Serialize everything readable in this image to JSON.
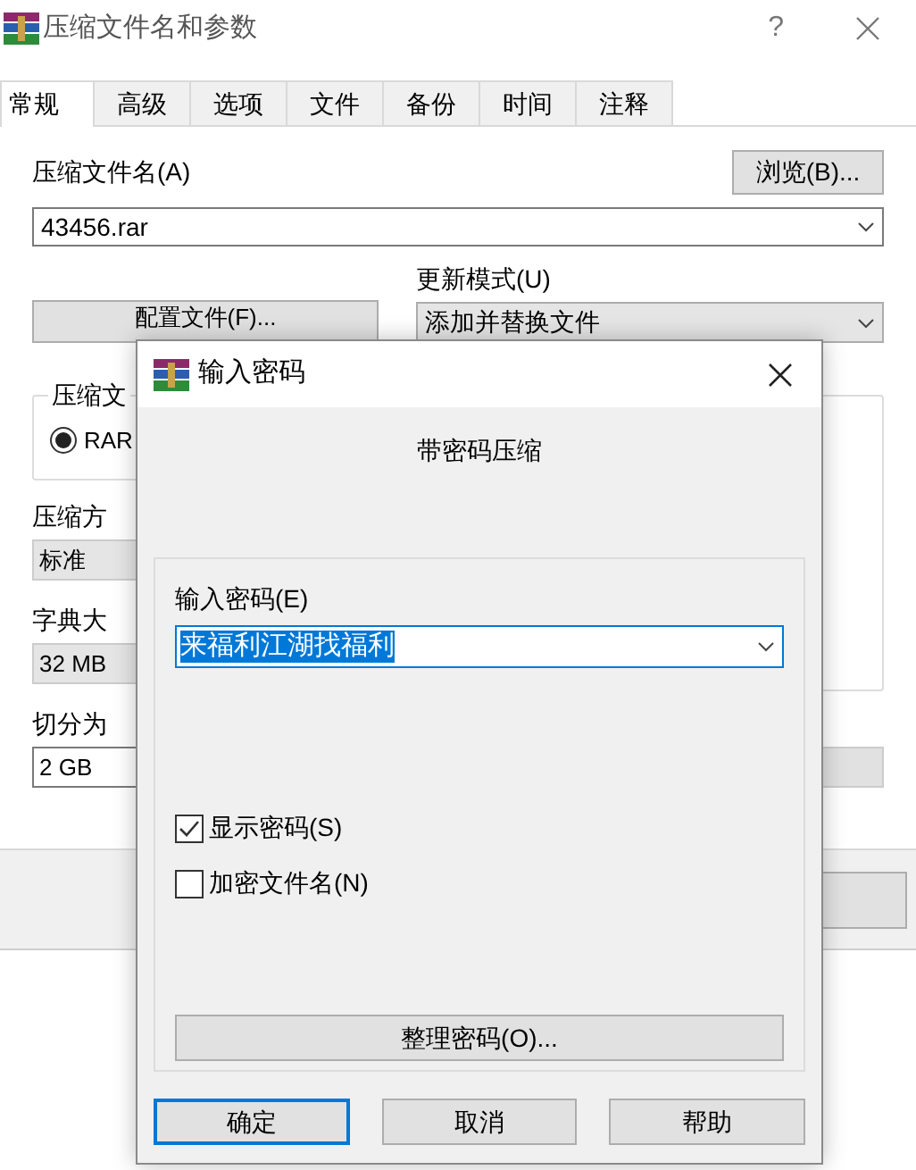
{
  "window": {
    "title": "压缩文件名和参数",
    "help": "?"
  },
  "tabs": [
    {
      "label": "常规",
      "selected": true
    },
    {
      "label": "高级",
      "selected": false
    },
    {
      "label": "选项",
      "selected": false
    },
    {
      "label": "文件",
      "selected": false
    },
    {
      "label": "备份",
      "selected": false
    },
    {
      "label": "时间",
      "selected": false
    },
    {
      "label": "注释",
      "selected": false
    }
  ],
  "archive_name": {
    "label": "压缩文件名(A)",
    "value": "43456.rar"
  },
  "browse_button": "浏览(B)...",
  "profiles_button": "配置文件(F)...",
  "update_mode": {
    "label": "更新模式(U)",
    "value": "添加并替换文件"
  },
  "format_group": {
    "label": "压缩文",
    "options": [
      {
        "label": "RAR",
        "selected": true
      }
    ]
  },
  "method": {
    "label": "压缩方",
    "value": "标准"
  },
  "dictionary": {
    "label": "字典大",
    "value": "32 MB"
  },
  "split": {
    "label": "切分为",
    "value": "2 GB"
  },
  "password_dialog": {
    "title": "输入密码",
    "heading": "带密码压缩",
    "password": {
      "label": "输入密码(E)",
      "value": "来福利江湖找福利",
      "selected": true
    },
    "options": [
      {
        "label": "显示密码(S)",
        "checked": true
      },
      {
        "label": "加密文件名(N)",
        "checked": false
      }
    ],
    "organize_button": "整理密码(O)...",
    "buttons": [
      {
        "label": "确定",
        "default": true
      },
      {
        "label": "取消",
        "default": false
      },
      {
        "label": "帮助",
        "default": false
      }
    ]
  }
}
